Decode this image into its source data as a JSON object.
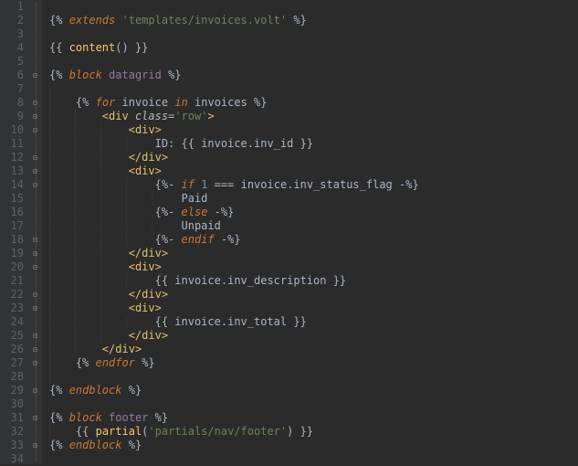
{
  "lines": [
    {
      "n": 1,
      "html": ""
    },
    {
      "n": 2,
      "html": "<span class='t-delim'>{%</span> <span class='t-kw'>extends</span> <span class='t-str'>'templates/invoices.volt'</span> <span class='t-delim'>%}</span>"
    },
    {
      "n": 3,
      "html": ""
    },
    {
      "n": 4,
      "html": "<span class='t-delim'>{{</span> <span class='t-func'>content</span><span class='t-delim'>()</span> <span class='t-delim'>}}</span>"
    },
    {
      "n": 5,
      "html": ""
    },
    {
      "n": 6,
      "html": "<span class='t-delim'>{%</span> <span class='t-kw'>block</span> <span class='t-name'>datagrid</span> <span class='t-delim'>%}</span>"
    },
    {
      "n": 7,
      "html": ""
    },
    {
      "n": 8,
      "html": "    <span class='t-delim'>{%</span> <span class='t-kw'>for</span> <span class='t-loopvar'>invoice</span> <span class='t-kw'>in</span> <span class='t-ident'>invoices</span> <span class='t-delim'>%}</span>"
    },
    {
      "n": 9,
      "html": "        <span class='t-tagang'>&lt;</span><span class='t-tag'>div</span> <span class='t-attr'>class</span><span class='t-op'>=</span><span class='t-str'>'row'</span><span class='t-tagang'>&gt;</span>"
    },
    {
      "n": 10,
      "html": "            <span class='t-tagang'>&lt;</span><span class='t-tag'>div</span><span class='t-tagang'>&gt;</span>"
    },
    {
      "n": 11,
      "html": "                <span class='t-text'>ID:</span> <span class='t-delim'>{{</span> <span class='t-ident'>invoice</span><span class='t-op'>.</span><span class='t-ident'>inv_id</span> <span class='t-delim'>}}</span>"
    },
    {
      "n": 12,
      "html": "            <span class='t-tagang'>&lt;/</span><span class='t-tag'>div</span><span class='t-tagang'>&gt;</span>"
    },
    {
      "n": 13,
      "html": "            <span class='t-tagang'>&lt;</span><span class='t-tag'>div</span><span class='t-tagang'>&gt;</span>"
    },
    {
      "n": 14,
      "html": "                <span class='t-delim'>{%-</span> <span class='t-kw'>if</span> <span class='t-num'>1</span> <span class='t-op'>===</span> <span class='t-ident'>invoice</span><span class='t-op'>.</span><span class='t-ident'>inv_status_flag</span> <span class='t-delim'>-%}</span>"
    },
    {
      "n": 15,
      "html": "                    <span class='t-text'>Paid</span>"
    },
    {
      "n": 16,
      "html": "                <span class='t-delim'>{%-</span> <span class='t-kw'>else</span> <span class='t-delim'>-%}</span>"
    },
    {
      "n": 17,
      "html": "                    <span class='t-text'>Unpaid</span>"
    },
    {
      "n": 18,
      "html": "                <span class='t-delim'>{%-</span> <span class='t-kw'>endif</span> <span class='t-delim'>-%}</span>"
    },
    {
      "n": 19,
      "html": "            <span class='t-tagang'>&lt;/</span><span class='t-tag'>div</span><span class='t-tagang'>&gt;</span>"
    },
    {
      "n": 20,
      "html": "            <span class='t-tagang'>&lt;</span><span class='t-tag'>div</span><span class='t-tagang'>&gt;</span>"
    },
    {
      "n": 21,
      "html": "                <span class='t-delim'>{{</span> <span class='t-ident'>invoice</span><span class='t-op'>.</span><span class='t-ident'>inv_description</span> <span class='t-delim'>}}</span>"
    },
    {
      "n": 22,
      "html": "            <span class='t-tagang'>&lt;/</span><span class='t-tag'>div</span><span class='t-tagang'>&gt;</span>"
    },
    {
      "n": 23,
      "html": "            <span class='t-tagang'>&lt;</span><span class='t-tag'>div</span><span class='t-tagang'>&gt;</span>"
    },
    {
      "n": 24,
      "html": "                <span class='t-delim'>{{</span> <span class='t-ident'>invoice</span><span class='t-op'>.</span><span class='t-ident'>inv_total</span> <span class='t-delim'>}}</span>"
    },
    {
      "n": 25,
      "html": "            <span class='t-tagang'>&lt;/</span><span class='t-tag'>div</span><span class='t-tagang'>&gt;</span>"
    },
    {
      "n": 26,
      "html": "        <span class='t-tagang'>&lt;/</span><span class='t-tag'>div</span><span class='t-tagang'>&gt;</span>"
    },
    {
      "n": 27,
      "html": "    <span class='t-delim'>{%</span> <span class='t-kw'>endfor</span> <span class='t-delim'>%}</span>"
    },
    {
      "n": 28,
      "html": ""
    },
    {
      "n": 29,
      "html": "<span class='t-delim'>{%</span> <span class='t-kw'>endblock</span> <span class='t-delim'>%}</span>"
    },
    {
      "n": 30,
      "html": ""
    },
    {
      "n": 31,
      "html": "<span class='t-delim'>{%</span> <span class='t-kw'>block</span> <span class='t-name'>footer</span> <span class='t-delim'>%}</span>"
    },
    {
      "n": 32,
      "html": "    <span class='t-delim'>{{</span> <span class='t-func'>partial</span><span class='t-delim'>(</span><span class='t-str'>'partials/nav/footer'</span><span class='t-delim'>)</span> <span class='t-delim'>}}</span>"
    },
    {
      "n": 33,
      "html": "<span class='t-delim'>{%</span> <span class='t-kw'>endblock</span> <span class='t-delim'>%}</span>"
    },
    {
      "n": 34,
      "html": ""
    }
  ],
  "indent_guides": {
    "1": 0,
    "2": 0,
    "3": 0,
    "4": 0,
    "5": 0,
    "6": 0,
    "7": 1,
    "8": 1,
    "9": 2,
    "10": 3,
    "11": 4,
    "12": 3,
    "13": 3,
    "14": 4,
    "15": 5,
    "16": 4,
    "17": 5,
    "18": 4,
    "19": 3,
    "20": 3,
    "21": 4,
    "22": 3,
    "23": 3,
    "24": 4,
    "25": 3,
    "26": 2,
    "27": 1,
    "28": 1,
    "29": 0,
    "30": 0,
    "31": 0,
    "32": 1,
    "33": 0,
    "34": 0
  },
  "fold_marks": {
    "6": "open",
    "8": "open",
    "9": "open",
    "10": "open",
    "12": "close",
    "13": "open",
    "14": "open",
    "18": "close",
    "19": "close",
    "20": "open",
    "22": "close",
    "23": "open",
    "25": "close",
    "26": "close",
    "27": "close",
    "29": "close",
    "31": "open",
    "33": "close"
  }
}
